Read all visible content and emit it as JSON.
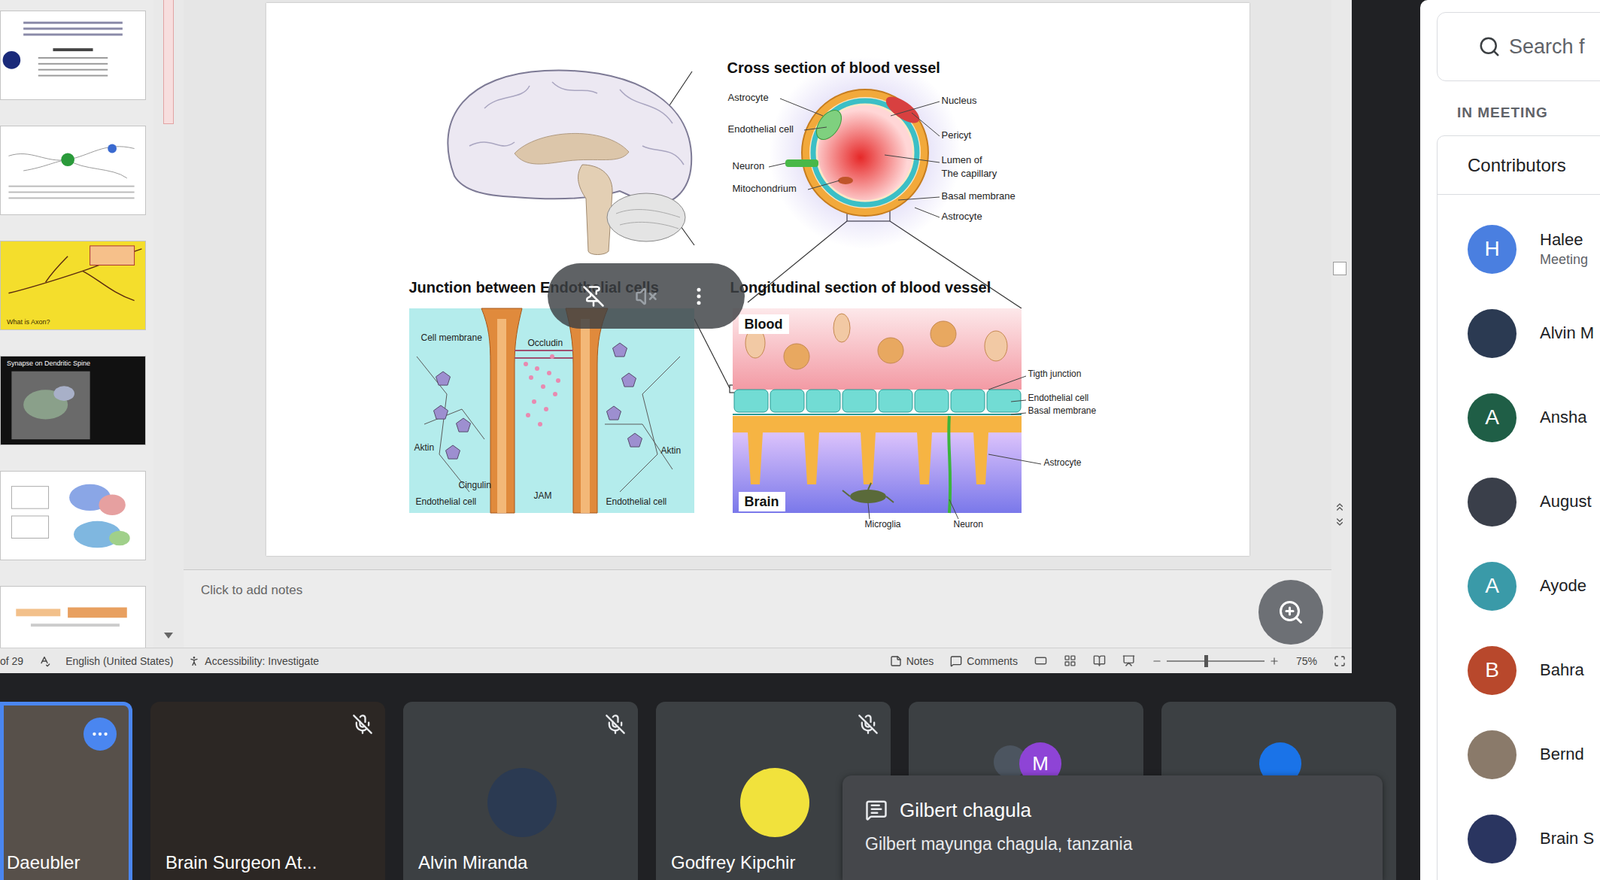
{
  "thumbnails": [
    {
      "kind": "title",
      "caption": ""
    },
    {
      "kind": "neuron",
      "caption": ""
    },
    {
      "kind": "axon",
      "caption": "What is Axon?"
    },
    {
      "kind": "synapse",
      "caption": "Synapse on Dendritic Spine"
    },
    {
      "kind": "brain",
      "caption": ""
    },
    {
      "kind": "figure",
      "caption": ""
    }
  ],
  "slide": {
    "cross_section": {
      "title": "Cross section of blood vessel",
      "labels_left": [
        "Astrocyte",
        "Endothelial cell",
        "Neuron",
        "Mitochondrium"
      ],
      "labels_right": [
        "Nucleus",
        "Pericyt",
        "Lumen of",
        "The capillary",
        "Basal membrane",
        "Astrocyte"
      ]
    },
    "junction": {
      "title": "Junction between Endothelial cells",
      "labels": [
        "Cell membrane",
        "Occludin",
        "Aktin",
        "Aktin",
        "Cingulin",
        "JAM",
        "Endothelial cell",
        "Endothelial cell"
      ]
    },
    "longitudinal": {
      "title": "Longitudinal section of blood vessel",
      "blood": "Blood",
      "brain": "Brain",
      "labels": [
        "Tigth junction",
        "Endothelial cell",
        "Basal membrane",
        "Astrocyte",
        "Microglia",
        "Neuron"
      ]
    }
  },
  "notes": {
    "placeholder": "Click to add notes"
  },
  "status_bar": {
    "slide_count": "of 29",
    "language": "English (United States)",
    "accessibility": "Accessibility: Investigate",
    "notes": "Notes",
    "comments": "Comments",
    "zoom": "75%",
    "zoom_level": 0.4
  },
  "tiles": [
    {
      "name": "Daeubler",
      "kind": "video",
      "muted": false,
      "speaking": true,
      "color": "#57504a"
    },
    {
      "name": "Brain Surgeon At...",
      "kind": "video",
      "muted": true,
      "speaking": false,
      "color": "#2c2724"
    },
    {
      "name": "Alvin Miranda",
      "kind": "avatar",
      "muted": true,
      "speaking": false,
      "color": "#2b3a52"
    },
    {
      "name": "Godfrey Kipchir",
      "kind": "avatar",
      "muted": true,
      "speaking": false,
      "color": "#f1e23c"
    },
    {
      "kind": "group",
      "initial": "M",
      "muted": false,
      "speaking": false,
      "color": "#8e44d6"
    },
    {
      "kind": "group",
      "initial": "",
      "muted": false,
      "speaking": false,
      "color": "#1a73e8"
    }
  ],
  "chat_toast": {
    "sender": "Gilbert chagula",
    "message": "Gilbert mayunga chagula, tanzania"
  },
  "people_panel": {
    "search_placeholder": "Search f",
    "section": "IN MEETING",
    "group": "Contributors",
    "people": [
      {
        "name": "Halee",
        "subtitle": "Meeting",
        "initial": "H",
        "kind": "initial",
        "color": "#4a7fe0"
      },
      {
        "name": "Alvin M",
        "subtitle": "",
        "initial": "",
        "kind": "photo",
        "color": "#2b3a52"
      },
      {
        "name": "Ansha",
        "subtitle": "",
        "initial": "A",
        "kind": "initial",
        "color": "#1f5e46"
      },
      {
        "name": "August",
        "subtitle": "",
        "initial": "",
        "kind": "photo",
        "color": "#3a3f4a"
      },
      {
        "name": "Ayode",
        "subtitle": "",
        "initial": "A",
        "kind": "initial",
        "color": "#3a9aa8"
      },
      {
        "name": "Bahra",
        "subtitle": "",
        "initial": "B",
        "kind": "initial",
        "color": "#b8482c"
      },
      {
        "name": "Bernd",
        "subtitle": "",
        "initial": "",
        "kind": "photo",
        "color": "#8a7a6a"
      },
      {
        "name": "Brain S",
        "subtitle": "",
        "initial": "",
        "kind": "photo",
        "color": "#2a3560"
      }
    ]
  }
}
